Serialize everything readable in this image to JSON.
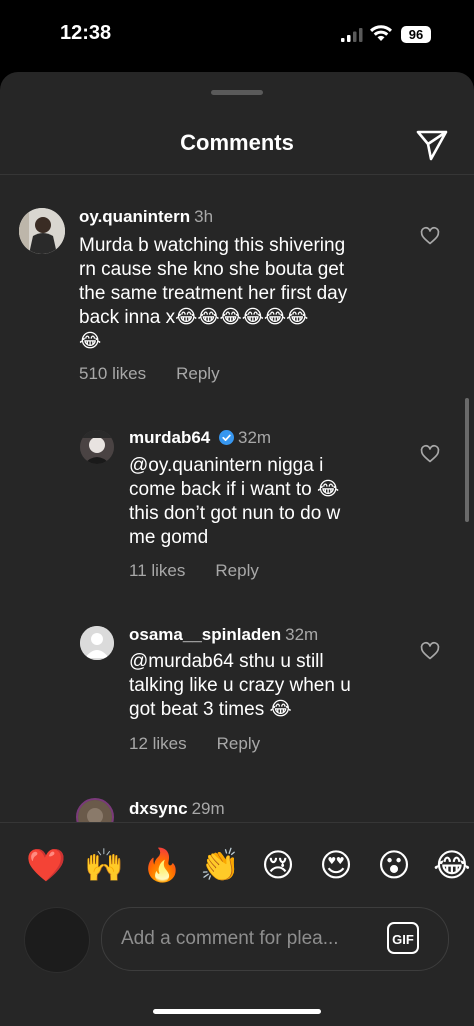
{
  "status_bar": {
    "time": "12:38",
    "battery": "96"
  },
  "sheet": {
    "title": "Comments"
  },
  "comments": [
    {
      "username": "oy.quanintern",
      "time": "3h",
      "text": "Murda b watching this shivering\nrn cause she kno she bouta get\nthe same treatment her first day\nback inna x😂😂😂😂😂😂\n😂",
      "likes": "510 likes",
      "reply": "Reply"
    },
    {
      "username": "murdab64",
      "verified": true,
      "time": "32m",
      "text": "@oy.quanintern nigga i\ncome back if i want to 😂\nthis don’t got nun to do w\nme gomd",
      "likes": "11 likes",
      "reply": "Reply"
    },
    {
      "username": "osama__spinladen",
      "time": "32m",
      "text": "@murdab64 sthu u still\ntalking like u crazy when u\ngot beat 3 times 😂",
      "likes": "12 likes",
      "reply": "Reply"
    },
    {
      "username": "dxsync",
      "time": "29m"
    }
  ],
  "emoji_bar": [
    "❤️",
    "🙌",
    "🔥",
    "👏",
    "😢",
    "😍",
    "😮",
    "😂"
  ],
  "composer": {
    "placeholder": "Add a comment for plea...",
    "gif_label": "GIF"
  },
  "colors": {
    "sheet_bg": "#262626",
    "muted_text": "#a8a8a8",
    "verified": "#3797f0"
  }
}
